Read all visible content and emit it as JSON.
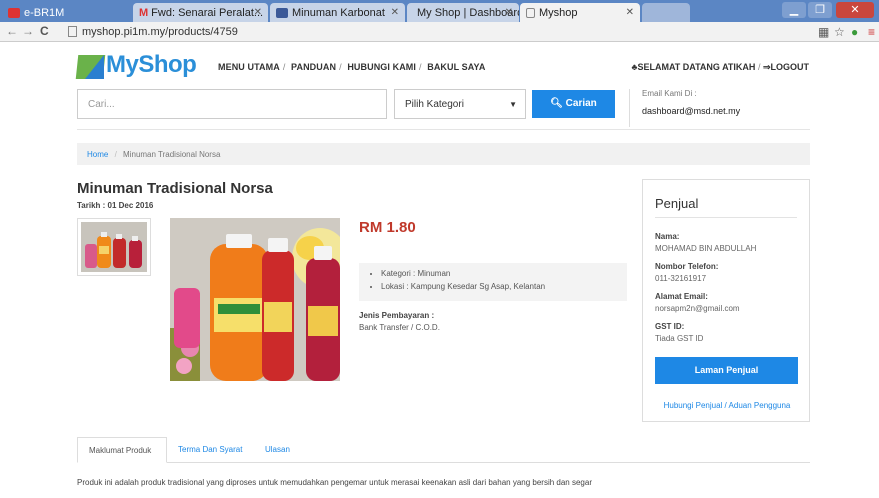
{
  "browser": {
    "tabs": [
      {
        "label": "e-BR1M"
      },
      {
        "label": "Fwd: Senarai Peralat..."
      },
      {
        "label": "Minuman Karbonat"
      },
      {
        "label": "My Shop | Dashboard"
      },
      {
        "label": "Myshop"
      }
    ],
    "url": "myshop.pi1m.my/products/4759"
  },
  "site": {
    "logo_text": "MyShop",
    "nav": [
      "MENU UTAMA",
      "PANDUAN",
      "HUBUNGI KAMI",
      "BAKUL SAYA"
    ],
    "welcome": "♣SELAMAT DATANG ATIKAH",
    "logout": "⇒LOGOUT",
    "search_placeholder": "Cari...",
    "category_select": "Pilih Kategori",
    "search_button": "Carian",
    "email_label": "Email Kami Di :",
    "email_value": "dashboard@msd.net.my"
  },
  "breadcrumb": {
    "home": "Home",
    "current": "Minuman Tradisional Norsa"
  },
  "product": {
    "title": "Minuman Tradisional Norsa",
    "date": "Tarikh : 01 Dec 2016",
    "price": "RM 1.80",
    "specs": [
      "Kategori : Minuman",
      "Lokasi : Kampung Kesedar Sg Asap, Kelantan"
    ],
    "payment_label": "Jenis Pembayaran :",
    "payment_value": "Bank Transfer / C.O.D."
  },
  "seller": {
    "heading": "Penjual",
    "name_label": "Nama:",
    "name_value": "MOHAMAD BIN ABDULLAH",
    "phone_label": "Nombor Telefon:",
    "phone_value": "011-32161917",
    "email_label": "Alamat Email:",
    "email_value": "norsapm2n@gmail.com",
    "gst_label": "GST ID:",
    "gst_value": "Tiada GST ID",
    "page_button": "Laman Penjual",
    "contact_link": "Hubungi Penjual / Aduan Pengguna"
  },
  "details": {
    "tabs": [
      "Maklumat Produk",
      "Terma Dan Syarat",
      "Ulasan"
    ],
    "description": "Produk ini adalah produk tradisional yang diproses untuk memudahkan pengemar untuk merasai keenakan asli dari bahan yang bersih dan segar"
  },
  "colors": {
    "accent": "#1e88e5",
    "price": "#c0392b",
    "brand": "#2b8fd8"
  }
}
